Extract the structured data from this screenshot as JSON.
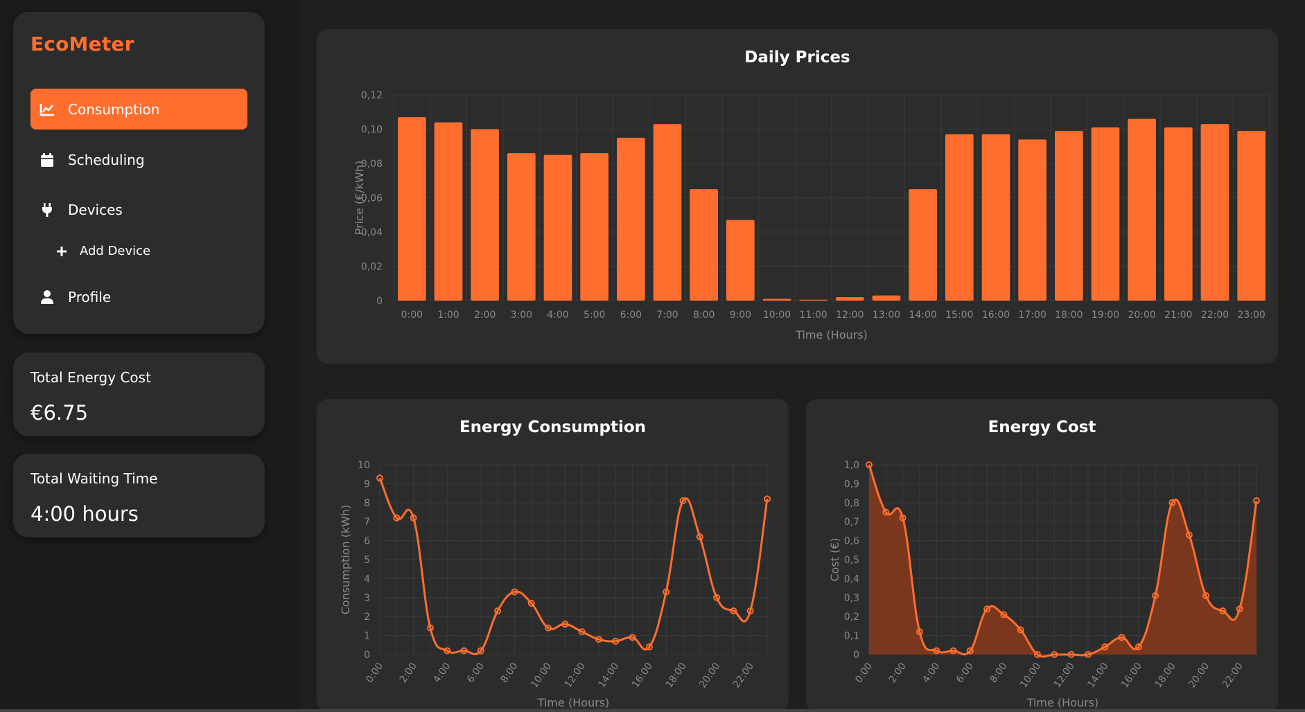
{
  "app": {
    "brand": "EcoMeter"
  },
  "nav": [
    {
      "label": "Consumption",
      "icon": "chart-line-icon",
      "active": true
    },
    {
      "label": "Scheduling",
      "icon": "calendar-icon",
      "active": false
    },
    {
      "label": "Devices",
      "icon": "plug-icon",
      "active": false
    },
    {
      "label": "Add Device",
      "icon": "plus-icon",
      "active": false
    },
    {
      "label": "Profile",
      "icon": "user-icon",
      "active": false
    }
  ],
  "stats": {
    "cost_label": "Total Energy Cost",
    "cost_value": "€6.75",
    "wait_label": "Total Waiting Time",
    "wait_value": "4:00 hours"
  },
  "colors": {
    "accent": "#ff6e2e",
    "card": "#2c2c2c",
    "bg": "#1c1c1c",
    "fill": "#8a3a1b"
  },
  "chart_data": [
    {
      "type": "bar",
      "title": "Daily Prices",
      "xlabel": "Time (Hours)",
      "ylabel": "Price (€/kWh)",
      "categories": [
        "0:00",
        "1:00",
        "2:00",
        "3:00",
        "4:00",
        "5:00",
        "6:00",
        "7:00",
        "8:00",
        "9:00",
        "10:00",
        "11:00",
        "12:00",
        "13:00",
        "14:00",
        "15:00",
        "16:00",
        "17:00",
        "18:00",
        "19:00",
        "20:00",
        "21:00",
        "22:00",
        "23:00"
      ],
      "values": [
        0.107,
        0.104,
        0.1,
        0.086,
        0.085,
        0.086,
        0.095,
        0.103,
        0.065,
        0.047,
        0.001,
        0.0005,
        0.002,
        0.003,
        0.065,
        0.097,
        0.097,
        0.094,
        0.099,
        0.101,
        0.106,
        0.101,
        0.103,
        0.099
      ],
      "ylim": [
        0,
        0.12
      ],
      "yticks": [
        "0",
        "0,02",
        "0,04",
        "0,06",
        "0,08",
        "0,10",
        "0,12"
      ],
      "grid": true
    },
    {
      "type": "line",
      "title": "Energy Consumption",
      "xlabel": "Time (Hours)",
      "ylabel": "Consumption (kWh)",
      "x": [
        "0:00",
        "1:00",
        "2:00",
        "3:00",
        "4:00",
        "5:00",
        "6:00",
        "7:00",
        "8:00",
        "9:00",
        "10:00",
        "11:00",
        "12:00",
        "13:00",
        "14:00",
        "15:00",
        "16:00",
        "17:00",
        "18:00",
        "19:00",
        "20:00",
        "21:00",
        "22:00",
        "23:00"
      ],
      "xticks": [
        "0:00",
        "2:00",
        "4:00",
        "6:00",
        "8:00",
        "10:00",
        "12:00",
        "14:00",
        "16:00",
        "18:00",
        "20:00",
        "22:00"
      ],
      "values": [
        9.3,
        7.2,
        7.2,
        1.4,
        0.2,
        0.2,
        0.2,
        2.3,
        3.3,
        2.7,
        1.4,
        1.6,
        1.2,
        0.8,
        0.7,
        0.9,
        0.4,
        3.3,
        8.1,
        6.2,
        3.0,
        2.3,
        2.3,
        8.2
      ],
      "ylim": [
        0,
        10
      ],
      "yticks": [
        "0",
        "1",
        "2",
        "3",
        "4",
        "5",
        "6",
        "7",
        "8",
        "9",
        "10"
      ],
      "grid": true
    },
    {
      "type": "area",
      "title": "Energy Cost",
      "xlabel": "Time (Hours)",
      "ylabel": "Cost (€)",
      "x": [
        "0:00",
        "1:00",
        "2:00",
        "3:00",
        "4:00",
        "5:00",
        "6:00",
        "7:00",
        "8:00",
        "9:00",
        "10:00",
        "11:00",
        "12:00",
        "13:00",
        "14:00",
        "15:00",
        "16:00",
        "17:00",
        "18:00",
        "19:00",
        "20:00",
        "21:00",
        "22:00",
        "23:00"
      ],
      "xticks": [
        "0:00",
        "2:00",
        "4:00",
        "6:00",
        "8:00",
        "10:00",
        "12:00",
        "14:00",
        "16:00",
        "18:00",
        "20:00",
        "22:00"
      ],
      "values": [
        1.0,
        0.75,
        0.72,
        0.12,
        0.02,
        0.02,
        0.02,
        0.24,
        0.21,
        0.13,
        0.0,
        0.0,
        0.0,
        0.0,
        0.04,
        0.09,
        0.04,
        0.31,
        0.8,
        0.63,
        0.31,
        0.23,
        0.24,
        0.81
      ],
      "ylim": [
        0,
        1.0
      ],
      "yticks": [
        "0",
        "0,1",
        "0,2",
        "0,3",
        "0,4",
        "0,5",
        "0,6",
        "0,7",
        "0,8",
        "0,9",
        "1,0"
      ],
      "grid": true
    }
  ]
}
